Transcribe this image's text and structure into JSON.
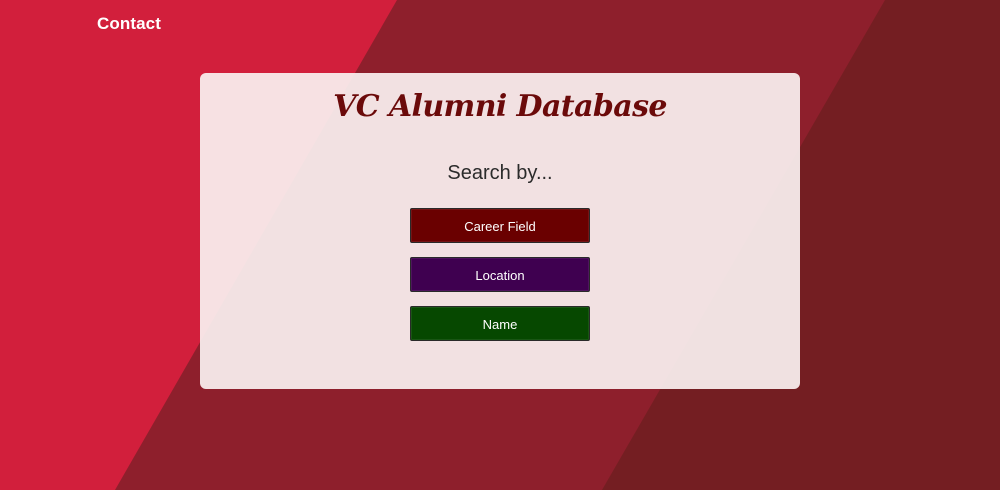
{
  "nav": {
    "contact_label": "Contact"
  },
  "card": {
    "title": "VC Alumni Database",
    "subtitle": "Search by..."
  },
  "search_options": [
    {
      "label": "Career Field",
      "color": "#6a0000"
    },
    {
      "label": "Location",
      "color": "#3f0050"
    },
    {
      "label": "Name",
      "color": "#064800"
    }
  ],
  "colors": {
    "background_red": "#d21f3c",
    "stripe_mid": "#8e1f2c",
    "stripe_dark": "#741e22",
    "title": "#6b0a0a"
  }
}
